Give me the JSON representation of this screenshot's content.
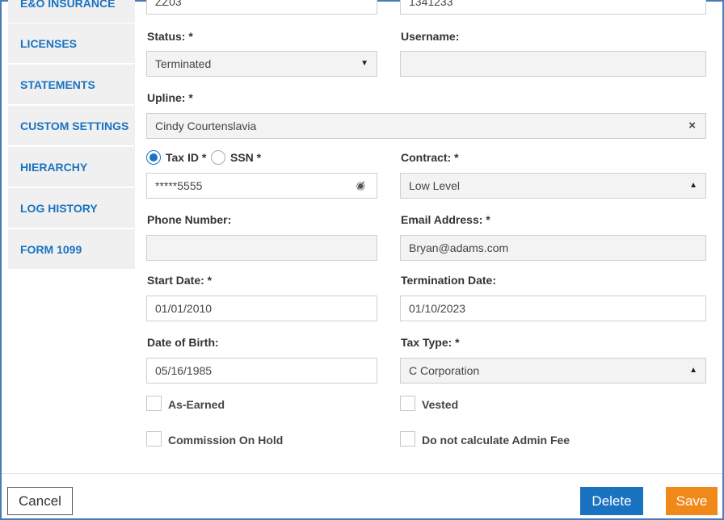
{
  "sidebar": {
    "items": [
      {
        "label": "E&O INSURANCE"
      },
      {
        "label": "LICENSES"
      },
      {
        "label": "STATEMENTS"
      },
      {
        "label": "CUSTOM SETTINGS"
      },
      {
        "label": "HIERARCHY"
      },
      {
        "label": "LOG HISTORY"
      },
      {
        "label": "FORM 1099"
      }
    ]
  },
  "form": {
    "top_left_value": "ZZ03",
    "top_right_value": "1341233",
    "status": {
      "label": "Status: *",
      "value": "Terminated"
    },
    "username": {
      "label": "Username:",
      "value": ""
    },
    "upline": {
      "label": "Upline: *",
      "value": "Cindy Courtenslavia"
    },
    "id_type": {
      "tax_id_label": "Tax ID *",
      "ssn_label": "SSN *",
      "selected": "Tax ID"
    },
    "tax_id": {
      "value": "*****5555"
    },
    "contract": {
      "label": "Contract: *",
      "value": "Low Level"
    },
    "phone": {
      "label": "Phone Number:",
      "value": ""
    },
    "email": {
      "label": "Email Address: *",
      "value": "Bryan@adams.com"
    },
    "start_date": {
      "label": "Start Date: *",
      "value": "01/01/2010"
    },
    "termination_date": {
      "label": "Termination Date:",
      "value": "01/10/2023"
    },
    "dob": {
      "label": "Date of Birth:",
      "value": "05/16/1985"
    },
    "tax_type": {
      "label": "Tax Type: *",
      "value": "C Corporation"
    },
    "checkboxes": {
      "as_earned": "As-Earned",
      "vested": "Vested",
      "commission_on_hold": "Commission On Hold",
      "no_admin_fee": "Do not calculate Admin Fee"
    }
  },
  "footer": {
    "cancel": "Cancel",
    "delete": "Delete",
    "save": "Save"
  },
  "colors": {
    "accent": "#1a73c0",
    "save": "#f0891a",
    "frame": "#4a7ab8"
  }
}
